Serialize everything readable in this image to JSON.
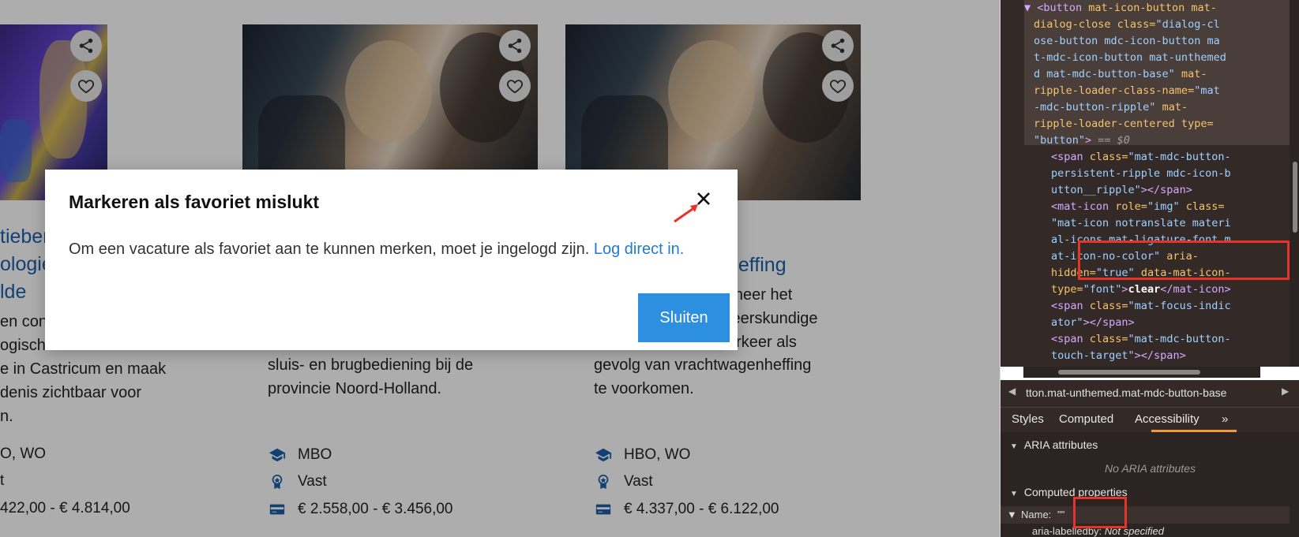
{
  "cards": [
    {
      "title_lines": [
        "tieber",
        "ologie",
        "lde"
      ],
      "desc_lines": [
        "en con",
        "ogische",
        "e in Castricum en maak",
        "denis zichtbaar voor",
        "n."
      ],
      "meta": [
        {
          "icon": "graduation-cap-icon",
          "text": "O, WO"
        },
        {
          "icon": "award-ribbon-icon",
          "text": "t"
        },
        {
          "icon": "wallet-icon",
          "text": "422,00 - € 4.814,00"
        }
      ]
    },
    {
      "title_lines": [],
      "desc_lines": [
        "sluis- en brugbediening bij de",
        "provincie Noord-Holland."
      ],
      "meta": [
        {
          "icon": "graduation-cap-icon",
          "text": "MBO"
        },
        {
          "icon": "award-ribbon-icon",
          "text": "Vast"
        },
        {
          "icon": "wallet-icon",
          "text": "€ 2.558,00 - € 3.456,00"
        }
      ]
    },
    {
      "title_lines": [
        "heffing"
      ],
      "desc_lines": [
        "lineer het",
        "teerskundige",
        "erkeer als",
        "gevolg van vrachtwagenheffing",
        "te voorkomen."
      ],
      "meta": [
        {
          "icon": "graduation-cap-icon",
          "text": "HBO, WO"
        },
        {
          "icon": "award-ribbon-icon",
          "text": "Vast"
        },
        {
          "icon": "wallet-icon",
          "text": "€ 4.337,00 - € 6.122,00"
        }
      ]
    }
  ],
  "dialog": {
    "title": "Markeren als favoriet mislukt",
    "body": "Om een vacature als favoriet aan te kunnen merken, moet je ingelogd zijn.",
    "link": "Log direct in.",
    "button": "Sluiten",
    "close_icon": "close-icon"
  },
  "devtools": {
    "code_lines": [
      {
        "p": "▼",
        "t": "<button",
        "a": " mat-icon-button mat-"
      },
      {
        "t": "",
        "a": "dialog-close class=",
        "v": "\"dialog-cl"
      },
      {
        "v": "ose-button mdc-icon-button ma"
      },
      {
        "v": "t-mdc-icon-button mat-unthemed"
      },
      {
        "v": "d mat-mdc-button-base\"",
        "a": " mat-"
      },
      {
        "a": "ripple-loader-class-name=",
        "v": "\"mat"
      },
      {
        "v": "-mdc-button-ripple\"",
        "a": " mat-"
      },
      {
        "a": "ripple-loader-centered type="
      },
      {
        "v": "\"button\"",
        "t": ">",
        "e": " == $0"
      }
    ],
    "code_lines2": [
      {
        "t": "<span",
        "a": " class=",
        "v": "\"mat-mdc-button-"
      },
      {
        "v": "persistent-ripple mdc-icon-b"
      },
      {
        "v": "utton__ripple\"",
        "t": "></span>"
      },
      {
        "t": "<mat-icon",
        "a": " role=",
        "v": "\"img\"",
        "a2": " class="
      },
      {
        "v": "\"mat-icon notranslate materi"
      },
      {
        "v": "al-icons mat-ligature-font m"
      },
      {
        "v": "at-icon-no-color\"",
        "a": " aria-"
      },
      {
        "a": "hidden=",
        "v": "\"true\"",
        "a2": " data-mat-icon-"
      },
      {
        "a": "type=",
        "v": "\"font\"",
        "t": ">",
        "x": "clear",
        "t2": "</mat-icon>"
      },
      {
        "t": "<span",
        "a": " class=",
        "v": "\"mat-focus-indic"
      },
      {
        "v": "ator\"",
        "t": "></span>"
      },
      {
        "t": "<span",
        "a": " class=",
        "v": "\"mat-mdc-button-"
      },
      {
        "v": "touch-target\"",
        "t": "></span>"
      }
    ],
    "breadcrumb": "tton.mat-unthemed.mat-mdc-button-base",
    "tabs": [
      "Styles",
      "Computed",
      "Accessibility"
    ],
    "more_tabs": "»",
    "aria_header": "ARIA attributes",
    "no_aria": "No ARIA attributes",
    "computed_header": "Computed properties",
    "name_label": "Name:",
    "name_value": "\"\"",
    "labelledby_label": "aria-labelledby:",
    "labelledby_value": "Not specified"
  }
}
